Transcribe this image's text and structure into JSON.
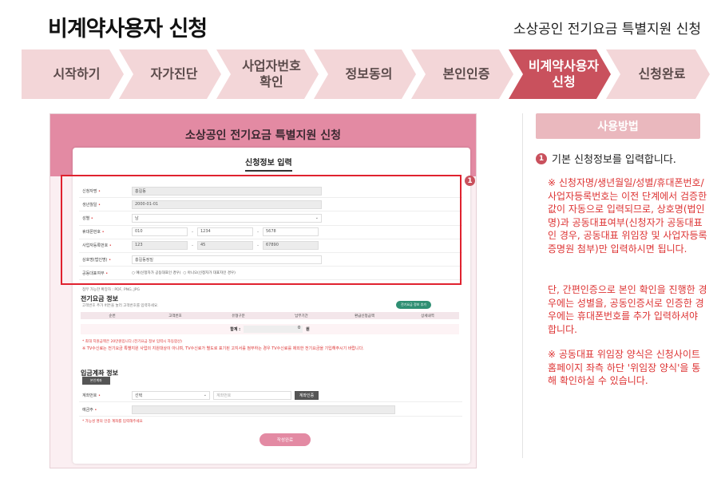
{
  "header": {
    "title": "비계약사용자 신청",
    "subtitle": "소상공인 전기요금 특별지원 신청"
  },
  "steps": [
    {
      "label": "시작하기",
      "active": false
    },
    {
      "label": "자가진단",
      "active": false
    },
    {
      "label": "사업자번호\n확인",
      "active": false
    },
    {
      "label": "정보동의",
      "active": false
    },
    {
      "label": "본인인증",
      "active": false
    },
    {
      "label": "비계약사용자\n신청",
      "active": true
    },
    {
      "label": "신청완료",
      "active": false
    }
  ],
  "screenshot": {
    "header_title": "소상공인 전기요금 특별지원 신청",
    "tab_title": "신청정보 입력",
    "badge": "1",
    "rows": {
      "name_label": "신청자명",
      "name_value": "홍길동",
      "birth_label": "생년월일",
      "birth_value": "2000-01-01",
      "gender_label": "성별",
      "gender_value": "남",
      "phone_label": "휴대폰번호",
      "phone_1": "010",
      "phone_2": "1234",
      "phone_3": "5678",
      "biz_label": "사업자등록번호",
      "biz_1": "123",
      "biz_2": "45",
      "biz_3": "67890",
      "company_label": "상호명(법인명)",
      "company_value": "홍길동정밀",
      "rep_label": "공동대표여부",
      "rep_option_yes": "예(신청자가 공동대표인 경우)",
      "rep_option_no": "아니오(신청자가 대표자인 경우)"
    },
    "file_note": "첨부 가능한 확장자 : PDF, PNG, JPG",
    "elec_title": "전기요금 정보",
    "elec_note": "고객번호 추가 버튼을 눌러 고객번호를 입력하세요.",
    "elec_add_button": "전기요금 정보 추가",
    "table_headers": [
      "순번",
      "고객번호",
      "유형구분",
      "납부기간",
      "환급신청금액",
      "상세내역"
    ],
    "sum_label": "합계 :",
    "sum_value": "0",
    "sum_unit": "원",
    "red_note_1": "* 최대 지원금액은 20만원입니다.(전기요금 정보 입력시 자동합산)",
    "red_note_2": "※ TV수신료는 전기요금 특별지원 사업의 지원대상이 아니며, TV수신료가 별도로 표기된 고지서를 첨부하는 경우 TV수신료를 제외한 전기요금을 기입해주시기 바랍니다.",
    "bank_title": "입금계좌 정보",
    "bank_tab": "본인계좌",
    "account_label": "계좌번호",
    "bank_select": "선택",
    "account_placeholder": "계좌번호",
    "verify_button": "계좌인증",
    "holder_label": "예금주",
    "bank_note": "* 가능성 명의 인증 계좌를 입력해주세요",
    "submit_label": "작성완료"
  },
  "sidebar": {
    "heading": "사용방법",
    "step_number": "1",
    "step_text": "기본 신청정보를 입력합니다.",
    "note_1": "※ 신청자명/생년월일/성별/휴대폰번호/사업자등록번호는 이전 단계에서 검증한 값이 자동으로 입력되므로, 상호명(법인명)과 공동대표여부(신청자가 공동대표인 경우, 공동대표 위임장 및 사업자등록증명원 첨부)만 입력하시면 됩니다.",
    "note_2": "단, 간편인증으로 본인 확인을 진행한 경우에는 성별을, 공동인증서로 인증한 경우에는 휴대폰번호를 추가 입력하셔야 합니다.",
    "note_3": "※ 공동대표 위임장 양식은 신청사이트 홈페이지 좌측 하단 '위임장 양식'을 통해 확인하실 수 있습니다."
  },
  "colors": {
    "active_step": "#c9515d",
    "inactive_step": "#f3d6d8",
    "highlight_box": "#e0222f",
    "note_text": "#dd3333"
  }
}
